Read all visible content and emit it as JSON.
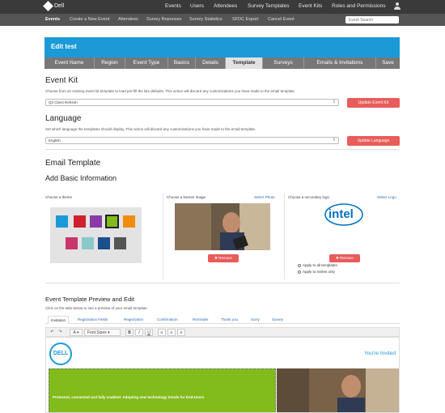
{
  "topbar": {
    "brand": "Dell",
    "nav": [
      "Events",
      "Users",
      "Attendees",
      "Survey Templates",
      "Event Kits",
      "Roles and Permissions"
    ]
  },
  "subnav": {
    "items": [
      "Events",
      "Create a New Event",
      "Attendees",
      "Survey Reponses",
      "Survey Statistics",
      "SFDC Export",
      "Cancel Event"
    ],
    "search_placeholder": "Event Search"
  },
  "page": {
    "title": "Edit test",
    "tabs": [
      "Event Name",
      "Region",
      "Event Type",
      "Basics",
      "Details",
      "Template",
      "Surveys",
      "Emails & Invitations",
      "Save"
    ],
    "active_tab": "Template"
  },
  "event_kit": {
    "heading": "Event Kit",
    "help": "Choose from an existing event kit template to load pre-fill the kits defaults. This action will discard any customizations you have made to the email template.",
    "selected": "Q3 Client Refresh",
    "button": "Update Event Kit"
  },
  "language": {
    "heading": "Language",
    "help": "Set which language the templates should display. This action will discard any customizations you have made to the email template.",
    "selected": "English",
    "button": "Update Language"
  },
  "email_template": {
    "heading": "Email Template",
    "subheading": "Add Basic Information",
    "theme_label": "Choose a theme",
    "banner_label": "Choose a banner image",
    "banner_link": "Select Photo",
    "logo_label": "Choose a secondary logo",
    "logo_link": "Select Logo",
    "logo_text": "intel",
    "remove": "Remove",
    "apply_all": "Apply to all templates",
    "apply_invites": "Apply to invites only",
    "theme_colors": [
      "#1c9ad8",
      "#d0202e",
      "#8a3aa8",
      "#82bb1c",
      "#f08c10",
      "#c8376e",
      "#8ac8cc",
      "#1a4f8a",
      "#555555"
    ],
    "selected_color": "#82bb1c"
  },
  "preview": {
    "heading": "Event Template Preview and Edit",
    "help": "Click on the tabs below to see a preview of your email template",
    "tabs": [
      "Invitation",
      "Registration Fields",
      "Registration",
      "Confirmation",
      "Reminder",
      "Thank you",
      "Sorry",
      "Survey"
    ],
    "active_tab": "Invitation",
    "font_sizes": "Font Sizes",
    "logo": "DELL",
    "youre_invited": "You're Invited",
    "banner_text": "Protected, connected and fully enabled: Adopting new technology trends for End-Users"
  }
}
